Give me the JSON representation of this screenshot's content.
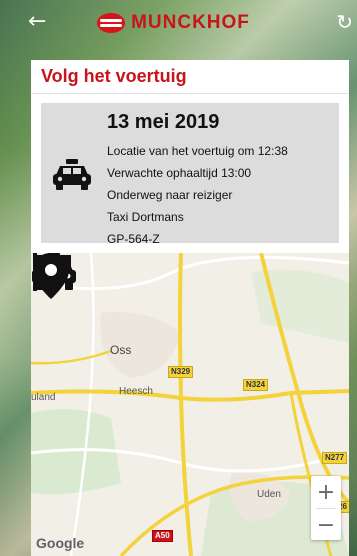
{
  "header": {
    "back_icon": "←",
    "refresh_icon": "↻",
    "brand": "MUNCKHOF"
  },
  "card": {
    "title": "Volg het voertuig"
  },
  "info": {
    "date": "13 mei 2019",
    "lines": [
      "Locatie van het voertuig om 12:38",
      "Verwachte ophaaltijd 13:00",
      "Onderweg naar reiziger",
      "Taxi Dortmans",
      "GP-564-Z"
    ]
  },
  "map": {
    "places": {
      "oss": "Oss",
      "heesch": "Heesch",
      "uland": "uland",
      "uden": "Uden"
    },
    "roads": {
      "n329": "N329",
      "n324": "N324",
      "n277": "N277",
      "a50": "A50",
      "n26": "26"
    },
    "zoom_in": "+",
    "zoom_out": "−",
    "attribution": "Google"
  },
  "colors": {
    "brand_red": "#c8141b",
    "info_bg": "#dcdcdc",
    "road_yellow": "#f4d23c"
  }
}
